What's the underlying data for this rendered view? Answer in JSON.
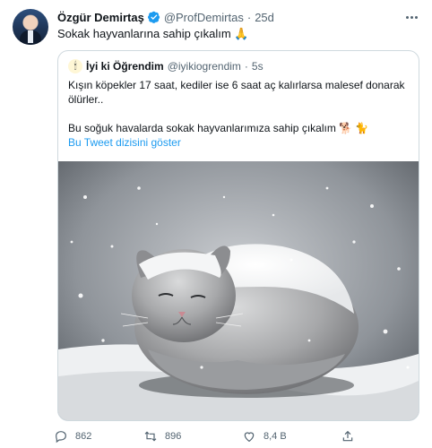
{
  "tweet": {
    "author_name": "Özgür Demirtaş",
    "handle": "@ProfDemirtas",
    "separator": "·",
    "time": "25d",
    "text": "Sokak hayvanlarına sahip çıkalım 🙏"
  },
  "quote": {
    "avatar_glyph": "🕯",
    "author_name": "İyi ki Öğrendim",
    "handle": "@iyikiogrendim",
    "separator": "·",
    "time": "5s",
    "line1": "Kışın köpekler 17 saat, kediler ise 6 saat aç kalırlarsa malesef donarak ölürler..",
    "line2": "Bu soğuk havalarda sokak hayvanlarımıza sahip çıkalım 🐕 🐈",
    "show_thread": "Bu Tweet dizisini göster"
  },
  "actions": {
    "reply_count": "862",
    "retweet_count": "896",
    "like_count": "8,4 B"
  },
  "colors": {
    "accent": "#1d9bf0",
    "secondary_text": "#536471",
    "border": "#cfd9de"
  }
}
